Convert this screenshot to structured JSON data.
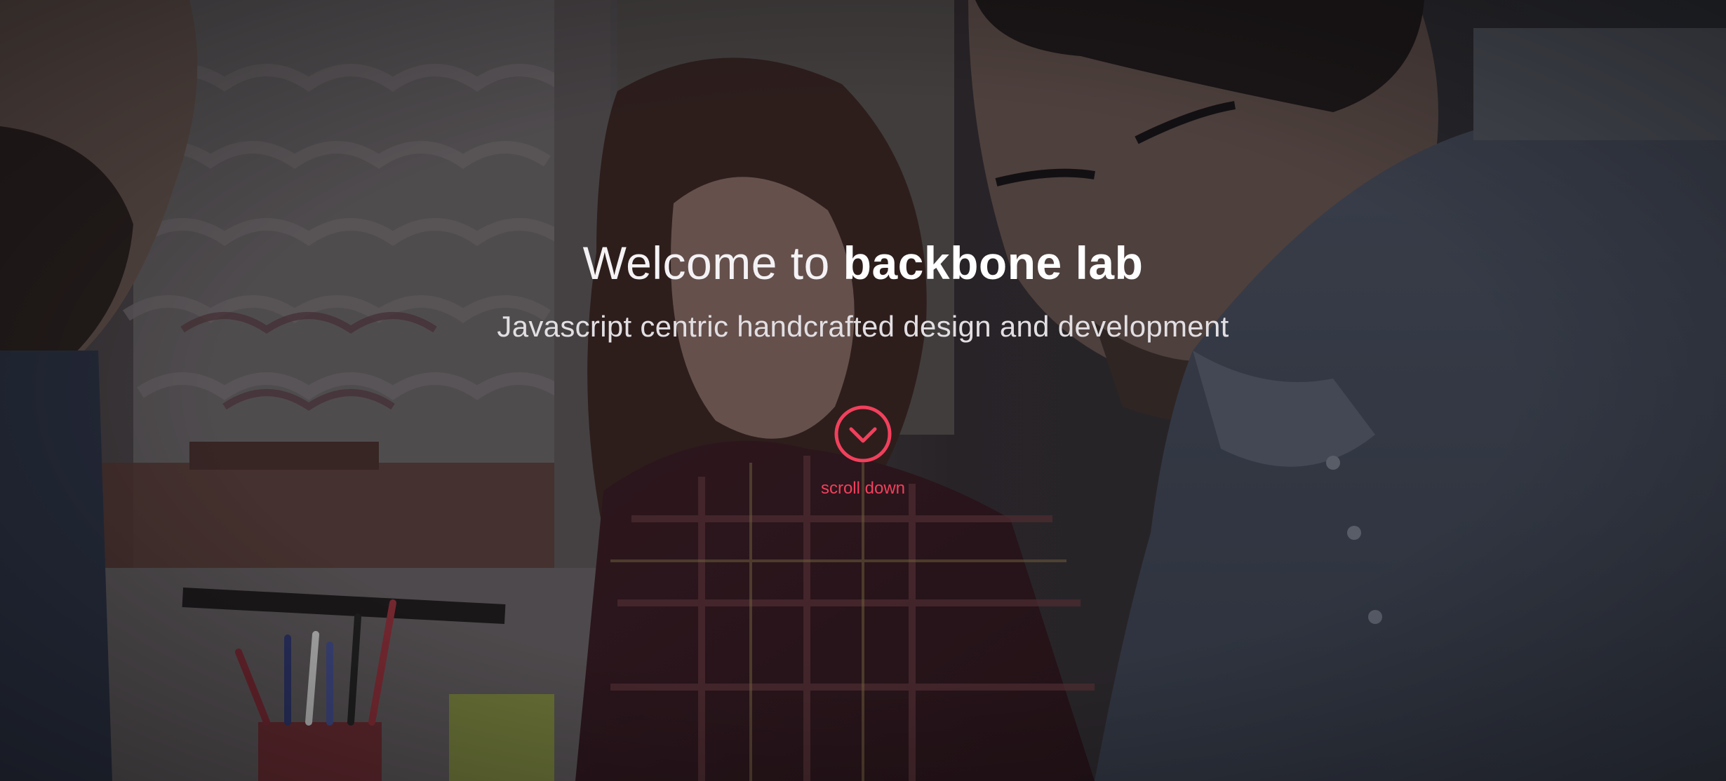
{
  "hero": {
    "title_prefix": "Welcome to ",
    "title_brand": "backbone lab",
    "subtitle": "Javascript centric handcrafted design and development",
    "scroll_label": "scroll down",
    "accent_color": "#f2405c",
    "icon": "chevron-down-circle-icon"
  }
}
